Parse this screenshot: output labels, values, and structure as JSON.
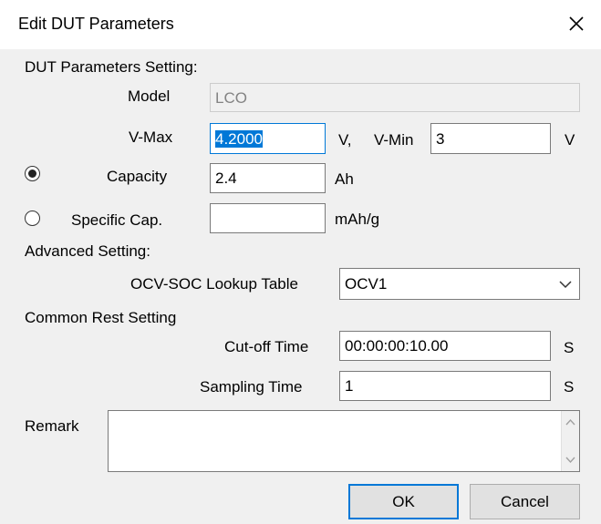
{
  "window": {
    "title": "Edit DUT Parameters"
  },
  "dut_section": {
    "heading": "DUT Parameters Setting:",
    "model_label": "Model",
    "model_value": "LCO",
    "vmax_label": "V-Max",
    "vmax_value": "4.2000",
    "vmax_unit": "V,",
    "vmin_label": "V-Min",
    "vmin_value": "3",
    "vmin_unit": "V",
    "capacity_label": "Capacity",
    "capacity_value": "2.4",
    "capacity_unit": "Ah",
    "capacity_selected": true,
    "specific_label": "Specific Cap.",
    "specific_value": "",
    "specific_unit": "mAh/g",
    "specific_selected": false
  },
  "advanced_section": {
    "heading": "Advanced Setting:",
    "ocv_label": "OCV-SOC Lookup Table",
    "ocv_selected": "OCV1"
  },
  "rest_section": {
    "heading": "Common Rest Setting",
    "cutoff_label": "Cut-off Time",
    "cutoff_value": "00:00:00:10.00",
    "cutoff_unit": "S",
    "sampling_label": "Sampling Time",
    "sampling_value": "1",
    "sampling_unit": "S"
  },
  "remark": {
    "label": "Remark",
    "value": ""
  },
  "buttons": {
    "ok_label": "OK",
    "cancel_label": "Cancel"
  },
  "colors": {
    "accent": "#0078d7",
    "background": "#f0f0f0"
  }
}
